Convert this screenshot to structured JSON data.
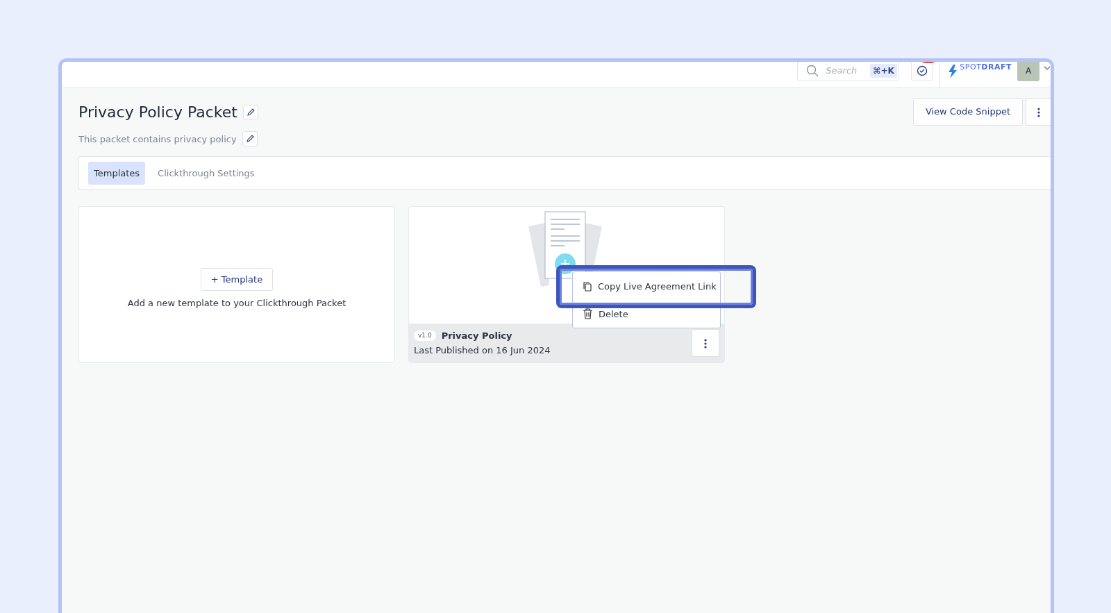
{
  "header": {
    "search": {
      "placeholder": "Search",
      "shortcut": "⌘+K"
    },
    "notifications": {
      "badge": true
    },
    "logo": "SPOT**DRAFT**",
    "avatar": "A"
  },
  "page": {
    "title": "Privacy Policy Packet",
    "description": "This packet contains privacy policy",
    "action_button": "View Code Snippet"
  },
  "tabs": [
    {
      "label": "Templates",
      "selected": true
    },
    {
      "label": "Clickthrough Settings",
      "selected": false
    }
  ],
  "add_card": {
    "button": "+ Template",
    "text": "Add a new template to your Clickthrough Packet"
  },
  "templates": [
    {
      "version": "v1.0",
      "name": "Privacy Policy",
      "published": "Last Published on 16 Jun 2024"
    }
  ],
  "menu": {
    "items": [
      {
        "kind": "copy",
        "label": "Copy Live Agreement Link",
        "highlighted": true
      },
      {
        "kind": "delete",
        "label": "Delete",
        "highlighted": false
      }
    ]
  }
}
